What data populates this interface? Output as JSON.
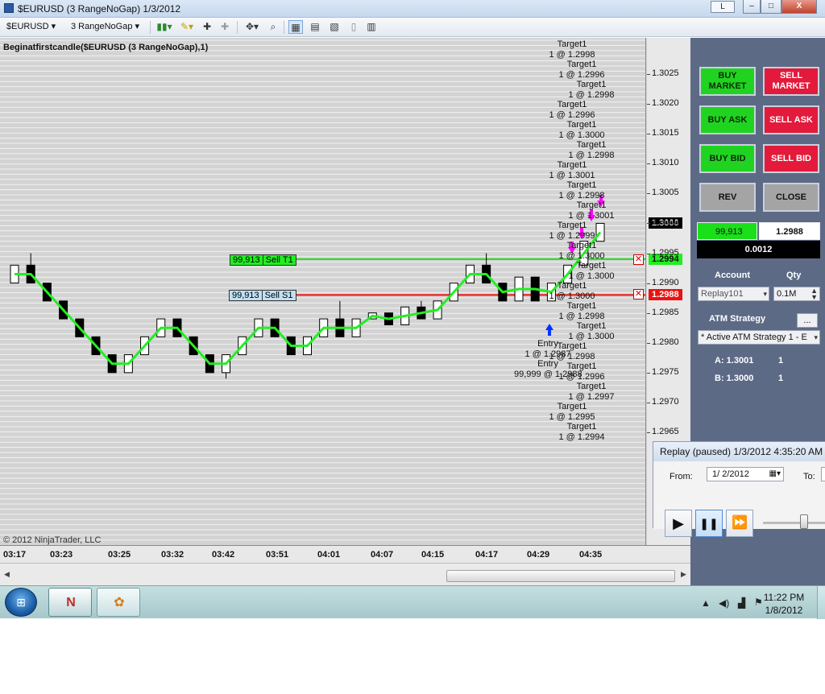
{
  "window": {
    "title": "$EURUSD (3 RangeNoGap)  1/3/2012",
    "l_button": "L",
    "minimize": "–",
    "maximize": "□",
    "close": "X"
  },
  "toolbar": {
    "instrument": "$EURUSD",
    "period": "3 RangeNoGap"
  },
  "chart": {
    "indicator_label": "Beginatfirstcandle($EURUSD (3 RangeNoGap),1)",
    "copyright": "© 2012 NinjaTrader, LLC",
    "f_box": "F",
    "y_ticks": [
      "1.3025",
      "1.3020",
      "1.3015",
      "1.3010",
      "1.3005",
      "1.3000",
      "1.2995",
      "1.2990",
      "1.2985",
      "1.2980",
      "1.2975",
      "1.2970",
      "1.2965"
    ],
    "x_ticks": [
      "03:17",
      "03:23",
      "03:25",
      "03:32",
      "03:42",
      "03:51",
      "04:01",
      "04:07",
      "04:15",
      "04:17",
      "04:29",
      "04:35"
    ],
    "last_price": "1.3000",
    "sell_t1": {
      "qty": "99,913",
      "label": "Sell T1",
      "price": "1.2994",
      "color": "#22dd22"
    },
    "sell_s1": {
      "qty": "99,913",
      "label": "Sell S1",
      "price": "1.2988",
      "color": "#ee1111"
    },
    "entry_annotation": [
      "Entry",
      "1 @ 1.2987",
      "Entry",
      "99,999 @ 1.2988"
    ],
    "target_annotations": [
      "Target1",
      "1 @ 1.2998",
      "Target1",
      "1 @ 1.2996",
      "Target1",
      "1 @ 1.2998",
      "Target1",
      "1 @ 1.2996",
      "Target1",
      "1 @ 1.3000",
      "Target1",
      "1 @ 1.2998",
      "Target1",
      "1 @ 1.3001",
      "Target1",
      "1 @ 1.2998",
      "Target1",
      "1 @ 1.3001",
      "Target1",
      "1 @ 1.2999",
      "Target1",
      "1 @ 1.3000",
      "Target1",
      "1 @ 1.3000",
      "Target1",
      "1 @ 1.3000",
      "Target1",
      "1 @ 1.2998",
      "Target1",
      "1 @ 1.3000",
      "Target1",
      "1 @ 1.2998",
      "Target1",
      "1 @ 1.2996",
      "Target1",
      "1 @ 1.2997",
      "Target1",
      "1 @ 1.2995",
      "Target1",
      "1 @ 1.2994"
    ],
    "colors": {
      "background": "#d3d3d3",
      "gridline": "#f2f2f2",
      "up_candle": "#ffffff",
      "down_candle": "#000000",
      "trend_line": "#22ee22",
      "marker": "#ff00ff",
      "entry_arrow": "#0033ff"
    }
  },
  "chart_data": {
    "type": "candlestick",
    "title": "",
    "xlabel": "",
    "ylabel": "",
    "ylim": [
      1.2962,
      1.303
    ],
    "x": [
      "03:17",
      "03:23",
      "03:25",
      "03:32",
      "03:42",
      "03:51",
      "04:01",
      "04:07",
      "04:15",
      "04:17",
      "04:29",
      "04:35"
    ],
    "ohlc": [
      [
        1.299,
        1.2993,
        1.299,
        1.2993
      ],
      [
        1.2993,
        1.2995,
        1.299,
        1.299
      ],
      [
        1.299,
        1.299,
        1.2987,
        1.2987
      ],
      [
        1.2987,
        1.2987,
        1.2984,
        1.2984
      ],
      [
        1.2984,
        1.2984,
        1.2981,
        1.2981
      ],
      [
        1.2981,
        1.2981,
        1.2978,
        1.2978
      ],
      [
        1.2978,
        1.2978,
        1.2975,
        1.2975
      ],
      [
        1.2975,
        1.2978,
        1.2975,
        1.2978
      ],
      [
        1.2978,
        1.2981,
        1.2978,
        1.2981
      ],
      [
        1.2981,
        1.2984,
        1.2981,
        1.2984
      ],
      [
        1.2984,
        1.2984,
        1.2981,
        1.2981
      ],
      [
        1.2981,
        1.2981,
        1.2978,
        1.2978
      ],
      [
        1.2978,
        1.2978,
        1.2975,
        1.2975
      ],
      [
        1.2975,
        1.2978,
        1.2974,
        1.2978
      ],
      [
        1.2978,
        1.2981,
        1.2978,
        1.2981
      ],
      [
        1.2981,
        1.2984,
        1.2981,
        1.2984
      ],
      [
        1.2984,
        1.2984,
        1.2981,
        1.2981
      ],
      [
        1.2981,
        1.2981,
        1.2978,
        1.2978
      ],
      [
        1.2978,
        1.2981,
        1.2978,
        1.2981
      ],
      [
        1.2981,
        1.2984,
        1.2981,
        1.2984
      ],
      [
        1.2984,
        1.2987,
        1.2981,
        1.2981
      ],
      [
        1.2981,
        1.2984,
        1.2981,
        1.2984
      ],
      [
        1.2984,
        1.2985,
        1.2984,
        1.2985
      ],
      [
        1.2985,
        1.2985,
        1.2983,
        1.2983
      ],
      [
        1.2983,
        1.2986,
        1.2983,
        1.2986
      ],
      [
        1.2986,
        1.2987,
        1.2984,
        1.2984
      ],
      [
        1.2984,
        1.2987,
        1.2984,
        1.2987
      ],
      [
        1.2987,
        1.299,
        1.2987,
        1.299
      ],
      [
        1.299,
        1.2993,
        1.299,
        1.2993
      ],
      [
        1.2993,
        1.2995,
        1.299,
        1.299
      ],
      [
        1.299,
        1.299,
        1.2987,
        1.2987
      ],
      [
        1.2987,
        1.2991,
        1.2987,
        1.2991
      ],
      [
        1.2991,
        1.2991,
        1.2987,
        1.2987
      ],
      [
        1.2987,
        1.299,
        1.2987,
        1.299
      ],
      [
        1.299,
        1.2993,
        1.299,
        1.2993
      ],
      [
        1.2993,
        1.2997,
        1.2993,
        1.2997
      ],
      [
        1.2997,
        1.3,
        1.2997,
        1.3
      ]
    ]
  },
  "panel": {
    "buy_market": "BUY MARKET",
    "sell_market": "SELL MARKET",
    "buy_ask": "BUY ASK",
    "sell_ask": "SELL ASK",
    "buy_bid": "BUY BID",
    "sell_bid": "SELL BID",
    "rev": "REV",
    "close": "CLOSE",
    "position_qty": "99,913",
    "avg_price": "1.2988",
    "pnl": "0.0012",
    "account_label": "Account",
    "qty_label": "Qty",
    "account_value": "Replay101",
    "qty_value": "0.1M",
    "atm_label": "ATM Strategy",
    "atm_button": "...",
    "atm_value": "* Active ATM Strategy 1 - E",
    "strategy_lines": [
      {
        "name": "A: 1.3001",
        "qty": "1"
      },
      {
        "name": "B: 1.3000",
        "qty": "1"
      }
    ]
  },
  "replay": {
    "title": "Replay (paused) 1/3/2012 4:35:20 AM",
    "from_label": "From:",
    "from_value": "1/  2/2012",
    "to_label": "To:",
    "play": "▶",
    "pause": "❚❚",
    "fast_forward": "⏩"
  },
  "taskbar": {
    "time": "11:22 PM",
    "date": "1/8/2012"
  }
}
